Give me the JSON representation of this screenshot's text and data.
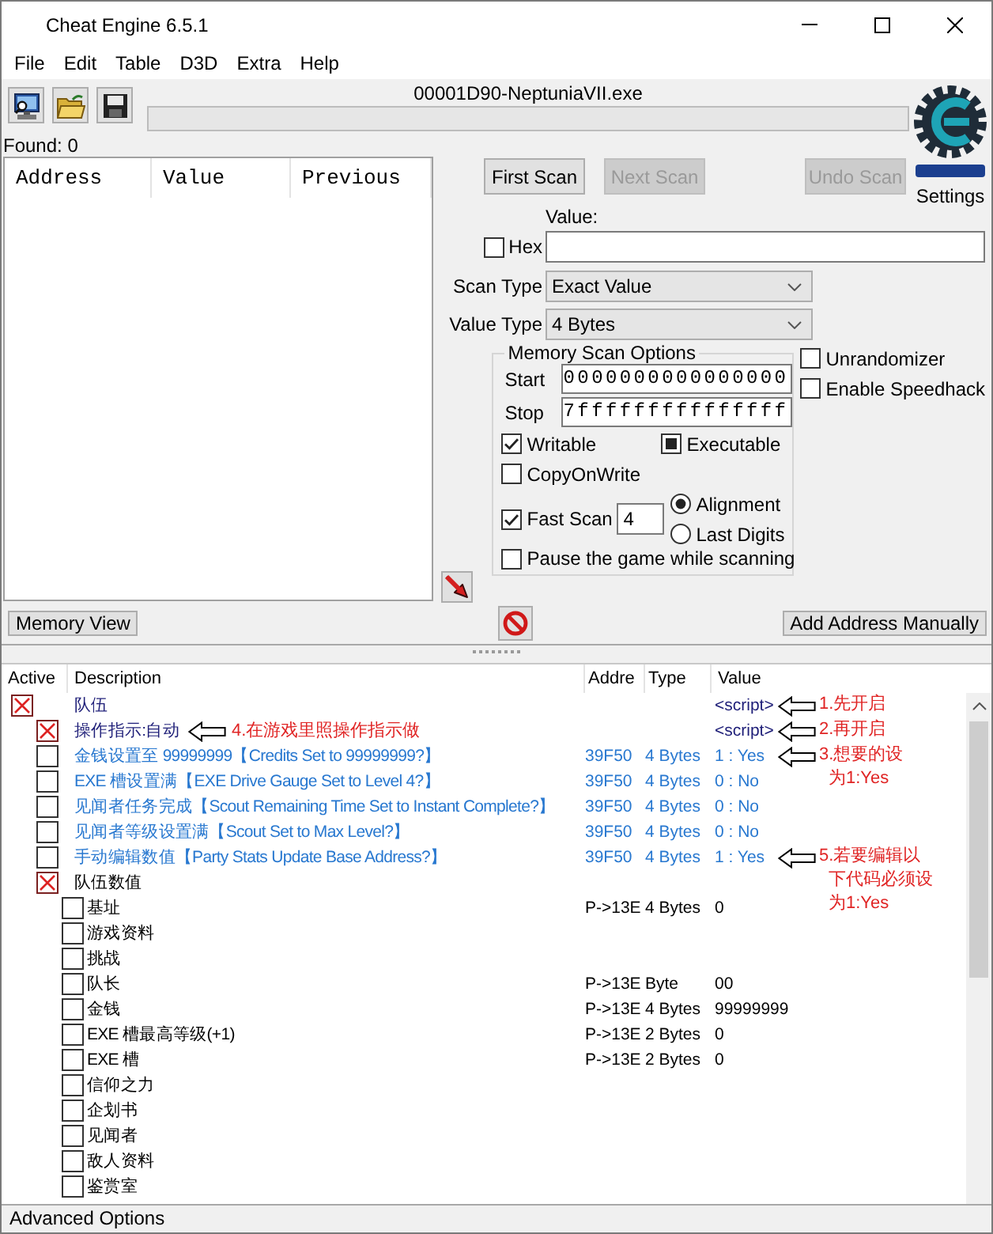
{
  "window": {
    "title": "Cheat Engine 6.5.1"
  },
  "menu": [
    "File",
    "Edit",
    "Table",
    "D3D",
    "Extra",
    "Help"
  ],
  "toolbar": {
    "process": "00001D90-NeptuniaVII.exe",
    "progress": {
      "level": 0
    },
    "settings": "Settings"
  },
  "found": "Found: 0",
  "scan_list": {
    "columns": [
      "Address",
      "Value",
      "Previous"
    ]
  },
  "scan_buttons": [
    {
      "label": "First Scan",
      "disabled": false
    },
    {
      "label": "Next Scan",
      "disabled": true
    },
    {
      "label": "Undo Scan",
      "disabled": true
    }
  ],
  "value": {
    "label": "Value:",
    "hex": {
      "label": "Hex",
      "checked": false
    }
  },
  "scan_type": {
    "label": "Scan Type",
    "value": "Exact Value"
  },
  "value_type": {
    "label": "Value Type",
    "value": "4 Bytes"
  },
  "memory_scan_options": {
    "title": "Memory Scan Options",
    "start": {
      "label": "Start",
      "value": "0000000000000000"
    },
    "stop": {
      "label": "Stop",
      "value": "7fffffffffffffff"
    },
    "flags": [
      {
        "label": "Writable",
        "checked": true,
        "indeterminate": false
      },
      {
        "label": "Executable",
        "checked": false,
        "indeterminate": true
      },
      {
        "label": "CopyOnWrite",
        "checked": false,
        "indeterminate": false
      }
    ],
    "fast_scan": {
      "label": "Fast Scan",
      "checked": true,
      "value": "4"
    },
    "alignment": [
      {
        "label": "Alignment",
        "selected": true
      },
      {
        "label": "Last Digits",
        "selected": false
      }
    ],
    "pause": {
      "label": "Pause the game while scanning",
      "checked": false
    }
  },
  "extra_options": [
    {
      "label": "Unrandomizer",
      "checked": false
    },
    {
      "label": "Enable Speedhack",
      "checked": false
    }
  ],
  "buttons": {
    "memory_view": "Memory View",
    "add_address": "Add Address Manually"
  },
  "table": {
    "columns": [
      "Active",
      "Description",
      "Addre",
      "Type",
      "Value"
    ],
    "rows": [
      {
        "active": true,
        "description": "队伍",
        "color": "#1e1e78",
        "value": "<script>",
        "value_note": [
          "1.先开启"
        ],
        "children": [
          {
            "active": true,
            "description": "操作指示:自动",
            "color": "#1e1e78",
            "description_note": "4.在游戏里照操作指示做",
            "value": "<script>",
            "value_note": [
              "2.再开启"
            ]
          },
          {
            "active": false,
            "description": "金钱设置至 99999999【Credits Set to 99999999?】",
            "color": "#2878d0",
            "address": "39F50",
            "type": "4 Bytes",
            "value": "1 : Yes",
            "value_note": [
              "3.想要的设",
              "为1:Yes"
            ]
          },
          {
            "active": false,
            "description": "EXE 槽设置满【EXE Drive Gauge Set to Level 4?】",
            "color": "#2878d0",
            "address": "39F50",
            "type": "4 Bytes",
            "value": "0 : No"
          },
          {
            "active": false,
            "description": "见闻者任务完成【Scout Remaining Time Set to Instant Complete?】",
            "color": "#2878d0",
            "address": "39F50",
            "type": "4 Bytes",
            "value": "0 : No"
          },
          {
            "active": false,
            "description": "见闻者等级设置满【Scout Set to Max Level?】",
            "color": "#2878d0",
            "address": "39F50",
            "type": "4 Bytes",
            "value": "0 : No"
          },
          {
            "active": false,
            "description": "手动编辑数值【Party Stats Update Base Address?】",
            "color": "#2878d0",
            "address": "39F50",
            "type": "4 Bytes",
            "value": "1 : Yes",
            "value_note": [
              "5.若要编辑以",
              "下代码必须设",
              "为1:Yes"
            ]
          },
          {
            "active": true,
            "description": "队伍数值",
            "color": "#000000",
            "children": [
              {
                "active": false,
                "description": "基址",
                "color": "#000000",
                "address": "P->13E",
                "type": "4 Bytes",
                "value": "0"
              },
              {
                "active": false,
                "description": "游戏资料",
                "color": "#000000"
              },
              {
                "active": false,
                "description": "挑战",
                "color": "#000000"
              },
              {
                "active": false,
                "description": "队长",
                "color": "#000000",
                "address": "P->13E",
                "type": "Byte",
                "value": "00"
              },
              {
                "active": false,
                "description": "金钱",
                "color": "#000000",
                "address": "P->13E",
                "type": "4 Bytes",
                "value": "99999999"
              },
              {
                "active": false,
                "description": "EXE 槽最高等级(+1)",
                "color": "#000000",
                "address": "P->13E",
                "type": "2 Bytes",
                "value": "0"
              },
              {
                "active": false,
                "description": "EXE 槽",
                "color": "#000000",
                "address": "P->13E",
                "type": "2 Bytes",
                "value": "0"
              },
              {
                "active": false,
                "description": "信仰之力",
                "color": "#000000"
              },
              {
                "active": false,
                "description": "企划书",
                "color": "#000000"
              },
              {
                "active": false,
                "description": "见闻者",
                "color": "#000000"
              },
              {
                "active": false,
                "description": "敌人资料",
                "color": "#000000"
              },
              {
                "active": false,
                "description": "鉴赏室",
                "color": "#000000"
              }
            ]
          }
        ]
      }
    ]
  },
  "status_bar": "Advanced Options"
}
